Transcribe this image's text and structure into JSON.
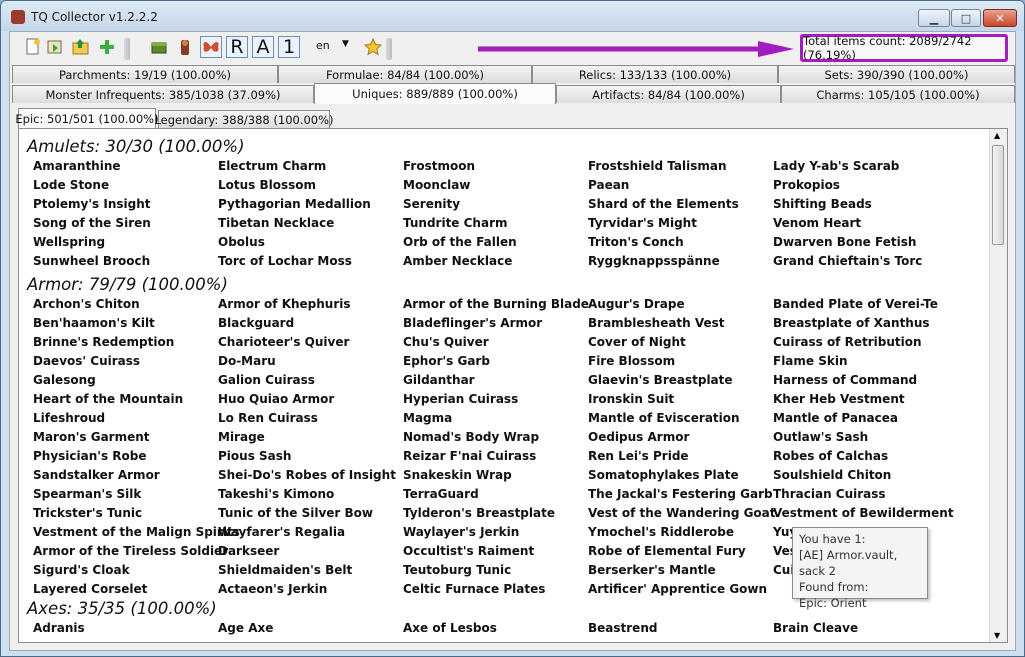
{
  "window": {
    "title": "TQ Collector v1.2.2.2",
    "min_icon": "minimize-icon",
    "max_icon": "maximize-icon",
    "close_icon": "close-icon"
  },
  "toolbar": {
    "letters": [
      "R",
      "A",
      "1"
    ],
    "language": "en",
    "total_items": "Total items count: 2089/2742 (76.19%)"
  },
  "colors": {
    "highlight": "#a21dc0",
    "arrow": "#a21dc0"
  },
  "tabs_row1": [
    "Parchments: 19/19 (100.00%)",
    "Formulae: 84/84 (100.00%)",
    "Relics: 133/133 (100.00%)",
    "Sets: 390/390 (100.00%)"
  ],
  "tabs_row2": [
    "Monster Infrequents: 385/1038 (37.09%)",
    "Uniques: 889/889 (100.00%)",
    "Artifacts: 84/84 (100.00%)",
    "Charms: 105/105 (100.00%)"
  ],
  "subtabs": [
    "Epic: 501/501 (100.00%)",
    "Legendary: 388/388 (100.00%)"
  ],
  "sections": [
    {
      "title": "Amulets: 30/30 (100.00%)",
      "items": [
        "Amaranthine",
        "Electrum Charm",
        "Frostmoon",
        "Frostshield Talisman",
        "Lady Y-ab's Scarab",
        "Lode Stone",
        "Lotus Blossom",
        "Moonclaw",
        "Paean",
        "Prokopios",
        "Ptolemy's Insight",
        "Pythagorian Medallion",
        "Serenity",
        "Shard of the Elements",
        "Shifting Beads",
        "Song of the Siren",
        "Tibetan Necklace",
        "Tundrite Charm",
        "Tyrvidar's Might",
        "Venom Heart",
        "Wellspring",
        "Obolus",
        "Orb of the Fallen",
        "Triton's Conch",
        "Dwarven Bone Fetish",
        "Sunwheel Brooch",
        "Torc of Lochar Moss",
        "Amber Necklace",
        "Ryggknappsspänne",
        "Grand Chieftain's Torc"
      ]
    },
    {
      "title": "Armor: 79/79 (100.00%)",
      "items": [
        "Archon's Chiton",
        "Armor of Khephuris",
        "Armor of the Burning Blade",
        "Augur's Drape",
        "Banded Plate of Verei-Te",
        "Ben'haamon's Kilt",
        "Blackguard",
        "Bladeflinger's Armor",
        "Bramblesheath Vest",
        "Breastplate of Xanthus",
        "Brinne's Redemption",
        "Charioteer's Quiver",
        "Chu's Quiver",
        "Cover of Night",
        "Cuirass of Retribution",
        "Daevos' Cuirass",
        "Do-Maru",
        "Ephor's Garb",
        "Fire Blossom",
        "Flame Skin",
        "Galesong",
        "Galion Cuirass",
        "Gildanthar",
        "Glaevin's Breastplate",
        "Harness of Command",
        "Heart of the Mountain",
        "Huo Quiao Armor",
        "Hyperian Cuirass",
        "Ironskin Suit",
        "Kher Heb Vestment",
        "Lifeshroud",
        "Lo Ren Cuirass",
        "Magma",
        "Mantle of Evisceration",
        "Mantle of Panacea",
        "Maron's Garment",
        "Mirage",
        "Nomad's Body Wrap",
        "Oedipus Armor",
        "Outlaw's Sash",
        "Physician's Robe",
        "Pious Sash",
        "Reizar F'nai Cuirass",
        "Ren Lei's Pride",
        "Robes of Calchas",
        "Sandstalker Armor",
        "Shei-Do's Robes of Insight",
        "Snakeskin Wrap",
        "Somatophylakes Plate",
        "Soulshield Chiton",
        "Spearman's Silk",
        "Takeshi's Kimono",
        "TerraGuard",
        "The Jackal's Festering Garb",
        "Thracian Cuirass",
        "Trickster's Tunic",
        "Tunic of the Silver Bow",
        "Tylderon's Breastplate",
        "Vest of the Wandering Goat",
        "Vestment of Bewilderment",
        "Vestment of the Malign Spirits",
        "Wayfarer's Regalia",
        "Waylayer's Jerkin",
        "Ymochel's Riddlerobe",
        "Yuy",
        "Armor of the Tireless Soldier",
        "Darkseer",
        "Occultist's Raiment",
        "Robe of Elemental Fury",
        "Ves",
        "Sigurd's Cloak",
        "Shieldmaiden's Belt",
        "Teutoburg Tunic",
        "Berserker's Mantle",
        "Cui",
        "Layered Corselet",
        "Actaeon's Jerkin",
        "Celtic Furnace Plates",
        "Artificer' Apprentice Gown",
        ""
      ]
    },
    {
      "title": "Axes: 35/35 (100.00%)",
      "items": [
        "Adranis",
        "Age Axe",
        "Axe of Lesbos",
        "Beastrend",
        "Brain Cleave"
      ]
    }
  ],
  "tooltip": {
    "line1": "You have 1:",
    "line2": "[AE] Armor.vault, sack 2",
    "line3": "Found from:",
    "line4": "Epic: Orient"
  }
}
